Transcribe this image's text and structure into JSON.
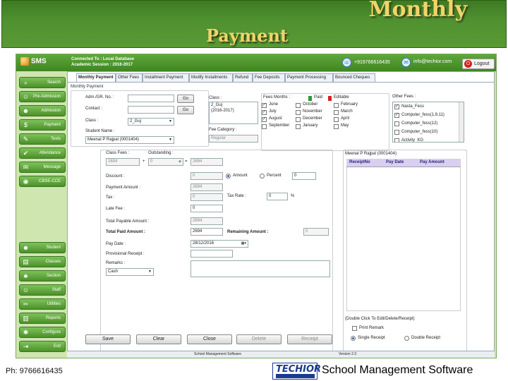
{
  "slide": {
    "title_line1": "Monthly",
    "title_line2": "Payment",
    "footer_phone": "Ph: 9766616435",
    "footer_title": "School Management Software"
  },
  "app": {
    "logo": "SMS",
    "connected": "Connected To : Local Database",
    "session": "Academic Session : 2016-2017",
    "phone": "+919766616435",
    "email": "info@techior.com",
    "logout": "Logout"
  },
  "sidebar_top": [
    "Search",
    "Pre-Admission",
    "Admission",
    "Payment",
    "Tests",
    "Attendance",
    "Message",
    "CBSE-CCE"
  ],
  "sidebar_bottom": [
    "Student",
    "Classes",
    "Section",
    "Staff",
    "Utilities",
    "Reports",
    "Configure",
    "Exit"
  ],
  "tabs": [
    "Monthly Payment",
    "Other Fees",
    "Installment Payment",
    "Modify Installments",
    "Refund",
    "Fee Deposits",
    "Payment Processing",
    "Bounced Cheques"
  ],
  "form": {
    "section_label": "Monthly Payment",
    "adm_label": "Adm./GR. No. :",
    "contact_label": "Contact :",
    "class_label": "Class :",
    "class_value": "2_Guj",
    "student_label": "Student Name :",
    "student_value": "Meenal P Rajpal (0001404)",
    "go": "Go",
    "class_list_label": "Class :",
    "class_list": [
      "2_Guj",
      "(2016-2017)"
    ],
    "fee_category_label": "Fee Category :",
    "fee_category_value": "Regular",
    "fees_months_label": "Fees Months :",
    "paid_label": "Paid",
    "editable_label": "Editable",
    "months": [
      {
        "name": "June",
        "checked": true
      },
      {
        "name": "July",
        "checked": true
      },
      {
        "name": "August",
        "checked": true
      },
      {
        "name": "September",
        "checked": false
      },
      {
        "name": "October",
        "checked": false
      },
      {
        "name": "November",
        "checked": false
      },
      {
        "name": "December",
        "checked": false
      },
      {
        "name": "January",
        "checked": false
      },
      {
        "name": "February",
        "checked": false
      },
      {
        "name": "March",
        "checked": false
      },
      {
        "name": "April",
        "checked": false
      },
      {
        "name": "May",
        "checked": false
      }
    ],
    "other_fees_label": "Other Fees :",
    "other_fees": [
      {
        "name": "Nasta_Fess",
        "checked": true
      },
      {
        "name": "Computer_fess(1,9,11)",
        "checked": true
      },
      {
        "name": "Computer_fess(12)",
        "checked": false
      },
      {
        "name": "Computer_fess(10)",
        "checked": false
      },
      {
        "name": "Activity_KG",
        "checked": false
      }
    ]
  },
  "calc": {
    "class_fees_label": "Class Fees :",
    "class_fees": "2694",
    "plus": "+",
    "outstanding_label": "Outstanding :",
    "outstanding": "0",
    "equals": "=",
    "total": "2694",
    "discount_label": "Discount :",
    "discount": "0",
    "amount_label": "Amount",
    "percent_label": "Percent",
    "discount_input": "0",
    "payment_amount_label": "Payment Amount :",
    "payment_amount": "2694",
    "tax_label": "Tax :",
    "tax": "0",
    "tax_rate_label": "Tax Rate :",
    "tax_rate": "0",
    "percent_sign": "%",
    "late_fee_label": "Late Fee :",
    "late_fee": "0",
    "total_payable_label": "Total Payable Amount :",
    "total_payable": "2694",
    "total_paid_label": "Total Paid Amount :",
    "total_paid": "2694",
    "remaining_label": "Remaining Amount :",
    "remaining": "0",
    "pay_date_label": "Pay Date :",
    "pay_date": "28/12/2016",
    "provisional_label": "Provisional Receipt :",
    "remarks_label": "Remarks :",
    "mode": "Cash"
  },
  "receipts": {
    "title": "Meenal P Rajpal (0001404)",
    "columns": [
      "ReceiptNo",
      "Pay Date",
      "Pay Amount"
    ],
    "hint": "(Double Click To Edit/Delete/Receipt)",
    "print_remark": "Print Remark",
    "single_receipt": "Single Receipt",
    "double_receipt": "Double Receipt"
  },
  "buttons": [
    "Save",
    "Clear",
    "Close",
    "Delete",
    "Receipt"
  ],
  "status": {
    "center": "School Management Software",
    "version": "Version 2.3"
  },
  "colors": {
    "paid": "#2e9a2e",
    "editable": "#d42020",
    "accent": "#4b9028"
  }
}
